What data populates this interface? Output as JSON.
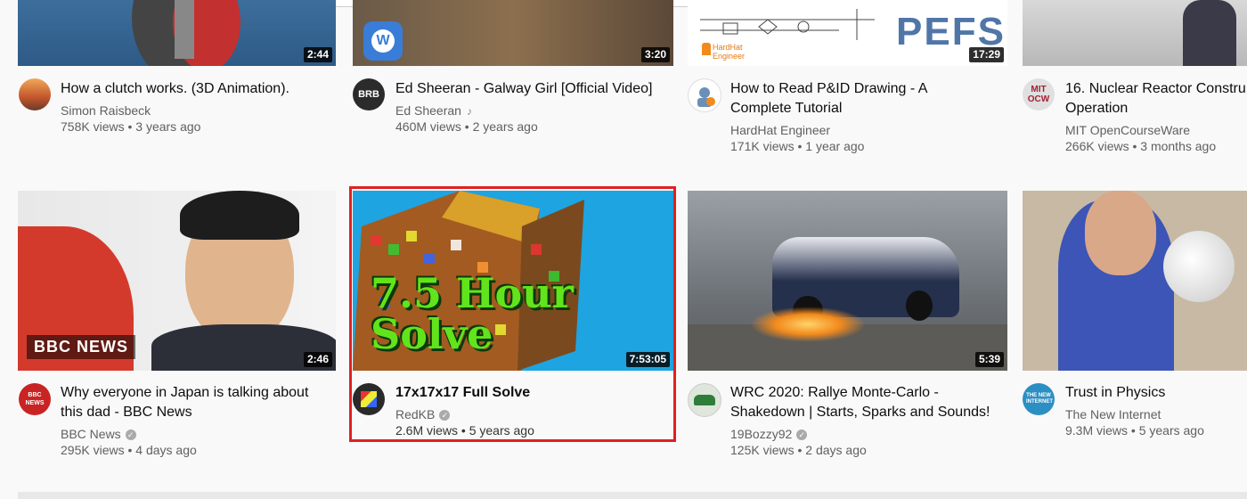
{
  "videos_row1": [
    {
      "title_line1": "How a clutch works. (3D Animation).",
      "title_line2": "",
      "channel": "Simon Raisbeck",
      "verified": false,
      "music": false,
      "stats": "758K views • 3 years ago",
      "duration": "2:44",
      "avatar_text": ""
    },
    {
      "title_line1": "Ed Sheeran - Galway Girl [Official Video]",
      "title_line2": "",
      "channel": "Ed Sheeran",
      "verified": false,
      "music": true,
      "stats": "460M views • 2 years ago",
      "duration": "3:20",
      "avatar_text": "BRB"
    },
    {
      "title_line1": "How to Read P&ID Drawing - A",
      "title_line2": "Complete Tutorial",
      "channel": "HardHat Engineer",
      "verified": false,
      "music": false,
      "stats": "171K views • 1 year ago",
      "duration": "17:29",
      "avatar_text": ""
    },
    {
      "title_line1": "16. Nuclear Reactor Constru",
      "title_line2": "Operation",
      "channel": "MIT OpenCourseWare",
      "verified": false,
      "music": false,
      "stats": "266K views • 3 months ago",
      "duration": "",
      "avatar_text": "MIT OCW"
    }
  ],
  "videos_row2": [
    {
      "title_line1": "Why everyone in Japan is talking about",
      "title_line2": "this dad - BBC News",
      "channel": "BBC News",
      "verified": true,
      "stats": "295K views • 4 days ago",
      "duration": "2:46",
      "avatar_text": "BBC NEWS",
      "thumb_text": "BBC NEWS"
    },
    {
      "title_line1": "17x17x17 Full Solve",
      "title_line2": "",
      "channel": "RedKB",
      "verified": true,
      "stats": "2.6M views • 5 years ago",
      "duration": "7:53:05",
      "thumb_text_line1": "7.5 Hour",
      "thumb_text_line2": "Solve"
    },
    {
      "title_line1": "WRC 2020: Rallye Monte-Carlo -",
      "title_line2": "Shakedown | Starts, Sparks and Sounds!",
      "channel": "19Bozzy92",
      "verified": true,
      "stats": "125K views • 2 days ago",
      "duration": "5:39"
    },
    {
      "title_line1": "Trust in Physics",
      "title_line2": "",
      "channel": "The New Internet",
      "verified": false,
      "stats": "9.3M views • 5 years ago",
      "duration": "",
      "avatar_text": "THE NEW INTERNET"
    }
  ],
  "thumb_texts": {
    "pefs": "PEFS",
    "hardhat": "HardHat Engineer"
  }
}
